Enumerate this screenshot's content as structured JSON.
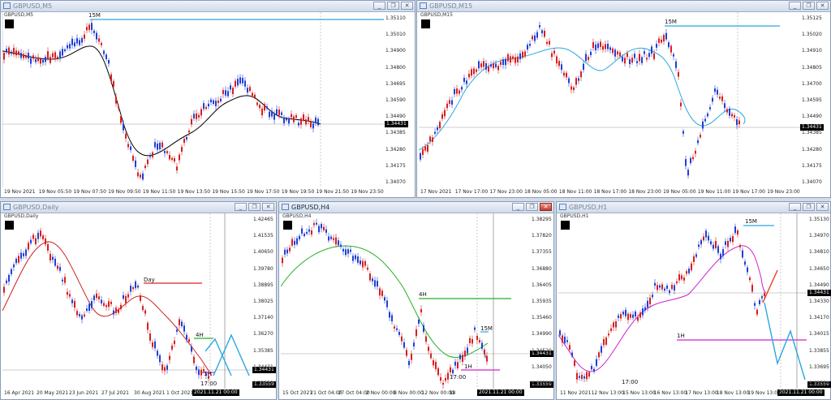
{
  "charts": [
    {
      "title": "GBPUSD,M5",
      "symbol_label": "GBPUSD,M5",
      "y_ticks": [
        "1.35110",
        "1.35010",
        "1.34900",
        "1.34800",
        "1.34695",
        "1.34590",
        "1.34490",
        "1.34385",
        "1.34280",
        "1.34175",
        "1.34070"
      ],
      "x_ticks": [
        "19 Nov 2021",
        "19 Nov 05:50",
        "19 Nov 07:50",
        "19 Nov 09:50",
        "19 Nov 11:50",
        "19 Nov 13:50",
        "19 Nov 15:50",
        "19 Nov 17:50",
        "19 Nov 19:50",
        "19 Nov 21:50",
        "19 Nov 23:50"
      ],
      "price_tag": "1.34431",
      "annotations": [
        "15M"
      ],
      "buttons": [
        "_",
        "❐",
        "✕"
      ]
    },
    {
      "title": "GBPUSD,M15",
      "symbol_label": "GBPUSD,M15",
      "y_ticks": [
        "1.35125",
        "1.35020",
        "1.34910",
        "1.34805",
        "1.34700",
        "1.34595",
        "1.34490",
        "1.34385",
        "1.34280",
        "1.34175",
        "1.34070"
      ],
      "x_ticks": [
        "17 Nov 2021",
        "17 Nov 17:00",
        "17 Nov 23:00",
        "18 Nov 05:00",
        "18 Nov 11:00",
        "18 Nov 17:00",
        "18 Nov 23:00",
        "19 Nov 05:00",
        "19 Nov 11:00",
        "19 Nov 17:00",
        "19 Nov 23:00"
      ],
      "price_tag": "1.34431",
      "annotations": [
        "15M"
      ],
      "buttons": [
        "_",
        "❐",
        "✕"
      ]
    },
    {
      "title": "GBPUSD,Daily",
      "symbol_label": "GBPUSD,Daily",
      "y_ticks": [
        "1.42465",
        "1.41535",
        "1.40650",
        "1.39780",
        "1.38895",
        "1.38025",
        "1.37140",
        "1.36270",
        "1.35385",
        "1.34431",
        "1.33559"
      ],
      "x_ticks": [
        "16 Apr 2021",
        "20 May 2021",
        "23 Jun 2021",
        "27 Jul 2021",
        "30 Aug 2021",
        "1 Oct 2021"
      ],
      "date_tag": "2021.11.21 00:00",
      "price_tag": "1.34431",
      "low_tag": "1.33559",
      "annotations": [
        "Day",
        "4H",
        "1H",
        "17:00"
      ],
      "buttons": [
        "_",
        "❐",
        "✕"
      ]
    },
    {
      "title": "GBPUSD,H4",
      "symbol_label": "GBPUSD,H4",
      "y_ticks": [
        "1.38295",
        "1.37820",
        "1.37355",
        "1.36880",
        "1.36405",
        "1.35935",
        "1.35460",
        "1.34990",
        "1.34520",
        "1.34050",
        "1.33559"
      ],
      "x_ticks": [
        "15 Oct 2021",
        "21 Oct 04:00",
        "27 Oct 04:00",
        "2 Nov 00:00",
        "8 Nov 00:00",
        "12 Nov 00:00",
        "18"
      ],
      "date_tag": "2021.11.21 00:00",
      "price_tag": "1.34431",
      "low_tag": "1.33559",
      "annotations": [
        "4H",
        "15M",
        "1H",
        "17:00"
      ],
      "buttons": [
        "_",
        "❐",
        "✕"
      ]
    },
    {
      "title": "GBPUSD,H1",
      "symbol_label": "GBPUSD,H1",
      "y_ticks": [
        "1.35130",
        "1.34970",
        "1.34810",
        "1.34650",
        "1.34490",
        "1.34330",
        "1.34170",
        "1.34015",
        "1.33855",
        "1.33695",
        "1.33559"
      ],
      "x_ticks": [
        "11 Nov 2021",
        "12 Nov 13:00",
        "15 Nov 13:00",
        "16 Nov 13:00",
        "17 Nov 13:00",
        "18 Nov 13:00",
        "19 Nov 13:00"
      ],
      "date_tag": "2021.11.21 00:00",
      "price_tag": "1.34431",
      "low_tag": "1.33559",
      "annotations": [
        "15M",
        "1H",
        "17:00"
      ],
      "buttons": [
        "_",
        "❐",
        "✕"
      ]
    }
  ],
  "colors": {
    "bull": "#1f3fd6",
    "bear": "#d61f1f",
    "accent": "#00aaff"
  }
}
